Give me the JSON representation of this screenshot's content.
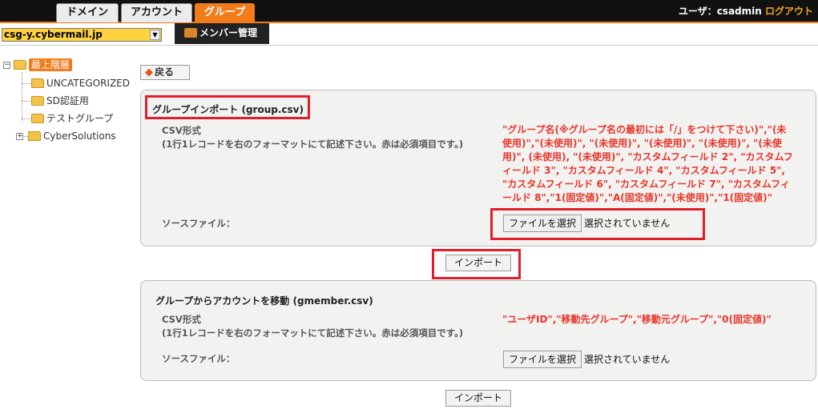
{
  "header": {
    "tabs": [
      {
        "label": "ドメイン"
      },
      {
        "label": "アカウント"
      },
      {
        "label": "グループ",
        "active": true
      }
    ],
    "user_prefix": "ユーザ：",
    "user_name": "csadmin",
    "logout": "ログアウト"
  },
  "subbar": {
    "domain_value": "csg-y.cybermail.jp",
    "member_tab_label": "メンバー管理"
  },
  "tree": {
    "root": "最上階層",
    "items": [
      {
        "label": "UNCATEGORIZED"
      },
      {
        "label": "SD認証用"
      },
      {
        "label": "テストグループ"
      },
      {
        "label": "CyberSolutions"
      }
    ]
  },
  "back_label": "戻る",
  "group_import": {
    "title": "グループインポート (group.csv)",
    "csv_label": "CSV形式",
    "csv_note": "(1行1レコードを右のフォーマットにて記述下さい。赤は必須項目です。)",
    "format_lines": [
      "\"グループ名(※グループ名の最初には「/」をつけて下さい)\",\"(未",
      "使用)\",\"(未使用)\", \"(未使用)\", \"(未使用)\", \"(未使用)\", \"(未使",
      "用)\", (未使用), \"(未使用)\", \"カスタムフィールド 2\", \"カスタムフ",
      "ィールド 3\", \"カスタムフィールド 4\", \"カスタムフィールド 5\",",
      "\"カスタムフィールド 6\", \"カスタムフィールド 7\", \"カスタムフィ",
      "ールド 8\",\"1(固定値)\",\"A(固定値)\",\"(未使用)\",\"1(固定値)\""
    ],
    "source_label": "ソースファイル：",
    "file_button": "ファイルを選択",
    "no_file": "選択されていません",
    "import_button": "インポート"
  },
  "member_move": {
    "title": "グループからアカウントを移動 (gmember.csv)",
    "csv_label": "CSV形式",
    "csv_note": "(1行1レコードを右のフォーマットにて記述下さい。赤は必須項目です。)",
    "format": "\"ユーザID\",\"移動先グループ\",\"移動元グループ\",\"0(固定値)\"",
    "source_label": "ソースファイル：",
    "file_button": "ファイルを選択",
    "no_file": "選択されていません",
    "import_button": "インポート"
  }
}
